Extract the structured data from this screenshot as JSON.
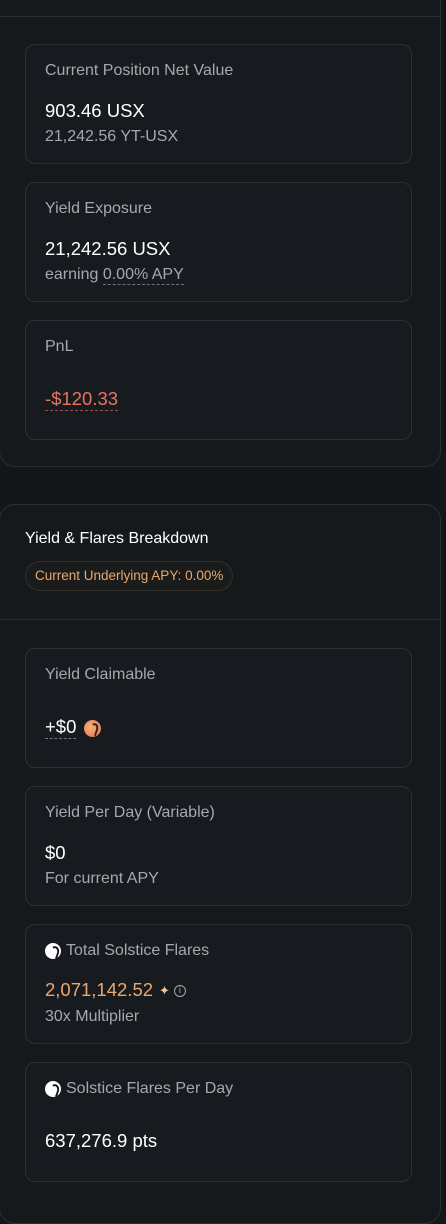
{
  "position": {
    "net_value": {
      "label": "Current Position Net Value",
      "value": "903.46 USX",
      "sub": "21,242.56 YT-USX"
    },
    "yield_exposure": {
      "label": "Yield Exposure",
      "value": "21,242.56 USX",
      "sub_prefix": "earning ",
      "sub_apy": "0.00% APY"
    },
    "pnl": {
      "label": "PnL",
      "value": "-$120.33"
    }
  },
  "breakdown": {
    "title": "Yield & Flares Breakdown",
    "underlying_apy": "Current Underlying APY: 0.00%",
    "yield_claimable": {
      "label": "Yield Claimable",
      "value": "+$0"
    },
    "yield_per_day": {
      "label": "Yield Per Day (Variable)",
      "value": "$0",
      "sub": "For current APY"
    },
    "total_flares": {
      "label": "Total Solstice Flares",
      "value": "2,071,142.52",
      "sub": "30x Multiplier"
    },
    "flares_per_day": {
      "label": "Solstice Flares Per Day",
      "value": "637,276.9 pts"
    }
  },
  "icons": {
    "flare": "flare-icon",
    "sparkle": "sparkle-icon",
    "info": "info-icon"
  },
  "colors": {
    "accent_orange": "#e9a86d",
    "negative": "#e8745d"
  }
}
